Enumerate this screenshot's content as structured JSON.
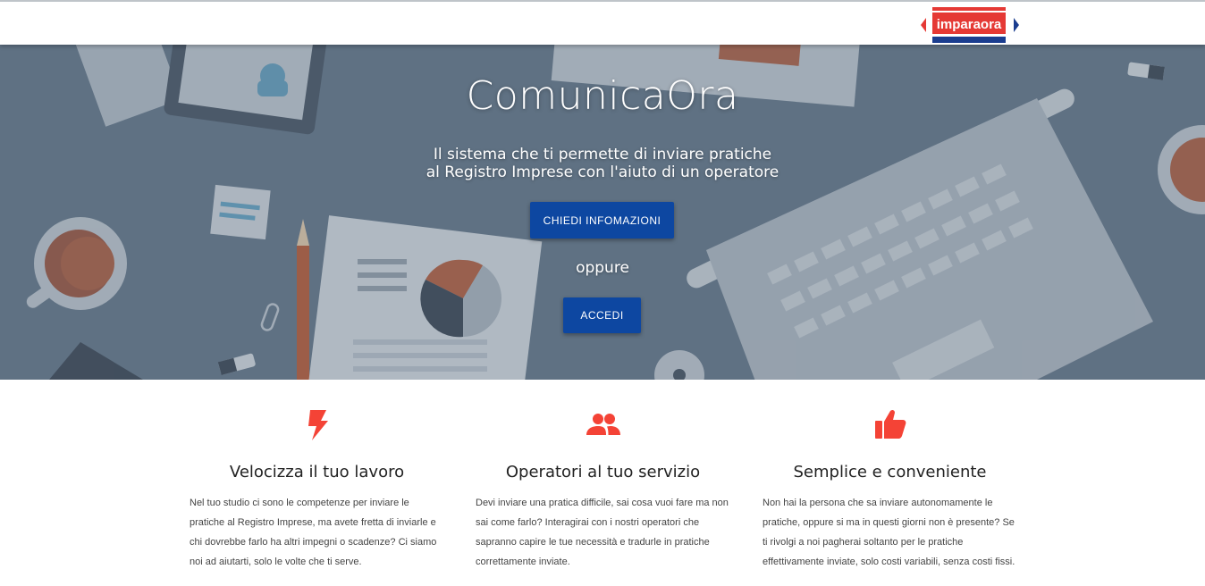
{
  "brand": {
    "logo_text": "imparaora"
  },
  "hero": {
    "title": "ComunicaOra",
    "subtitle_line1": "Il sistema che ti permette di inviare pratiche",
    "subtitle_line2": "al Registro Imprese con l'aiuto di un operatore",
    "info_button": "CHIEDI INFOMAZIONI",
    "or_text": "oppure",
    "login_button": "ACCEDI"
  },
  "features": [
    {
      "icon": "lightning-bolt-icon",
      "title": "Velocizza il tuo lavoro",
      "text": "Nel tuo studio ci sono le competenze per inviare le pratiche al Registro Imprese, ma avete fretta di inviarle e chi dovrebbe farlo ha altri impegni o scadenze? Ci siamo noi ad aiutarti, solo le volte che ti serve."
    },
    {
      "icon": "people-group-icon",
      "title": "Operatori al tuo servizio",
      "text": "Devi inviare una pratica difficile, sai cosa vuoi fare ma non sai come farlo? Interagirai con i nostri operatori che sapranno capire le tue necessità e tradurle in pratiche correttamente inviate."
    },
    {
      "icon": "thumbs-up-icon",
      "title": "Semplice e conveniente",
      "text": "Non hai la persona che sa inviare autonomamente le pratiche, oppure si ma in questi giorni non è presente? Se ti rivolgi a noi pagherai soltanto per le pratiche effettivamente inviate, solo costi variabili, senza costi fissi."
    }
  ],
  "colors": {
    "accent": "#0d47a1",
    "icon_red": "#f44336",
    "hero_bg": "#5f7183"
  }
}
